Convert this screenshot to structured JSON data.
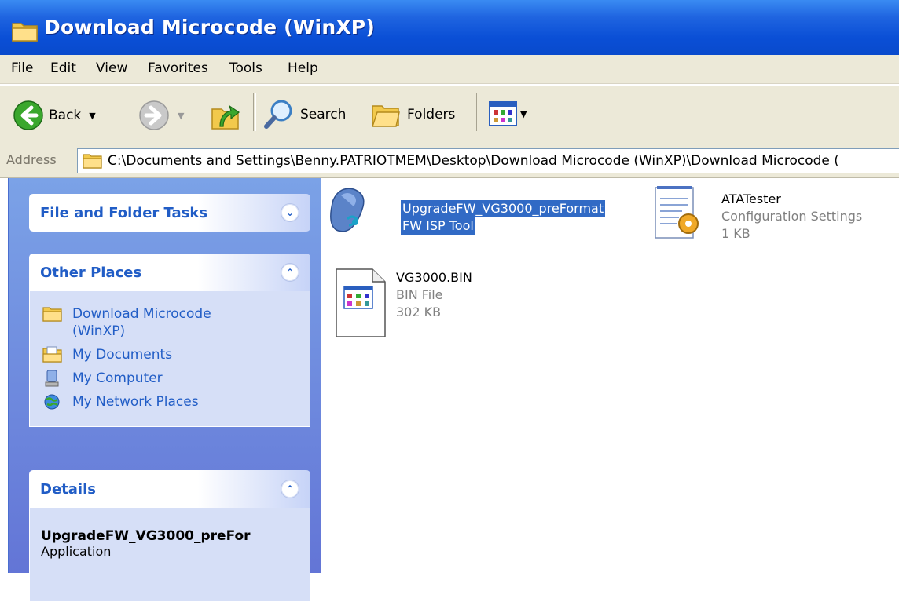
{
  "window": {
    "title": "Download Microcode (WinXP)"
  },
  "menu": [
    "File",
    "Edit",
    "View",
    "Favorites",
    "Tools",
    "Help"
  ],
  "toolbar": {
    "back": "Back",
    "search": "Search",
    "folders": "Folders"
  },
  "address": {
    "label": "Address",
    "value": "C:\\Documents and Settings\\Benny.PATRIOTMEM\\Desktop\\Download Microcode (WinXP)\\Download Microcode ("
  },
  "tasks": {
    "file_folder": {
      "title": "File and Folder Tasks"
    },
    "other_places": {
      "title": "Other Places",
      "items": [
        {
          "label": "Download Microcode (WinXP)",
          "icon": "folder-icon"
        },
        {
          "label": "My Documents",
          "icon": "my-documents-icon"
        },
        {
          "label": "My Computer",
          "icon": "my-computer-icon"
        },
        {
          "label": "My Network Places",
          "icon": "network-places-icon"
        }
      ]
    },
    "details": {
      "title": "Details",
      "name": "UpgradeFW_VG3000_preFor",
      "type": "Application"
    }
  },
  "files": [
    {
      "name_line1": "UpgradeFW_VG3000_preFormat",
      "name_line2": "FW ISP Tool",
      "icon": "application-icon",
      "selected": true
    },
    {
      "name": "ATATester",
      "type": "Configuration Settings",
      "size": "1 KB",
      "icon": "config-settings-icon"
    },
    {
      "name": "VG3000.BIN",
      "type": "BIN File",
      "size": "302 KB",
      "icon": "bin-file-icon"
    }
  ],
  "colors": {
    "titlebar": "#0a4fd6",
    "pane_link": "#215dc6",
    "selection": "#316ac5",
    "chrome": "#ece9d8"
  }
}
